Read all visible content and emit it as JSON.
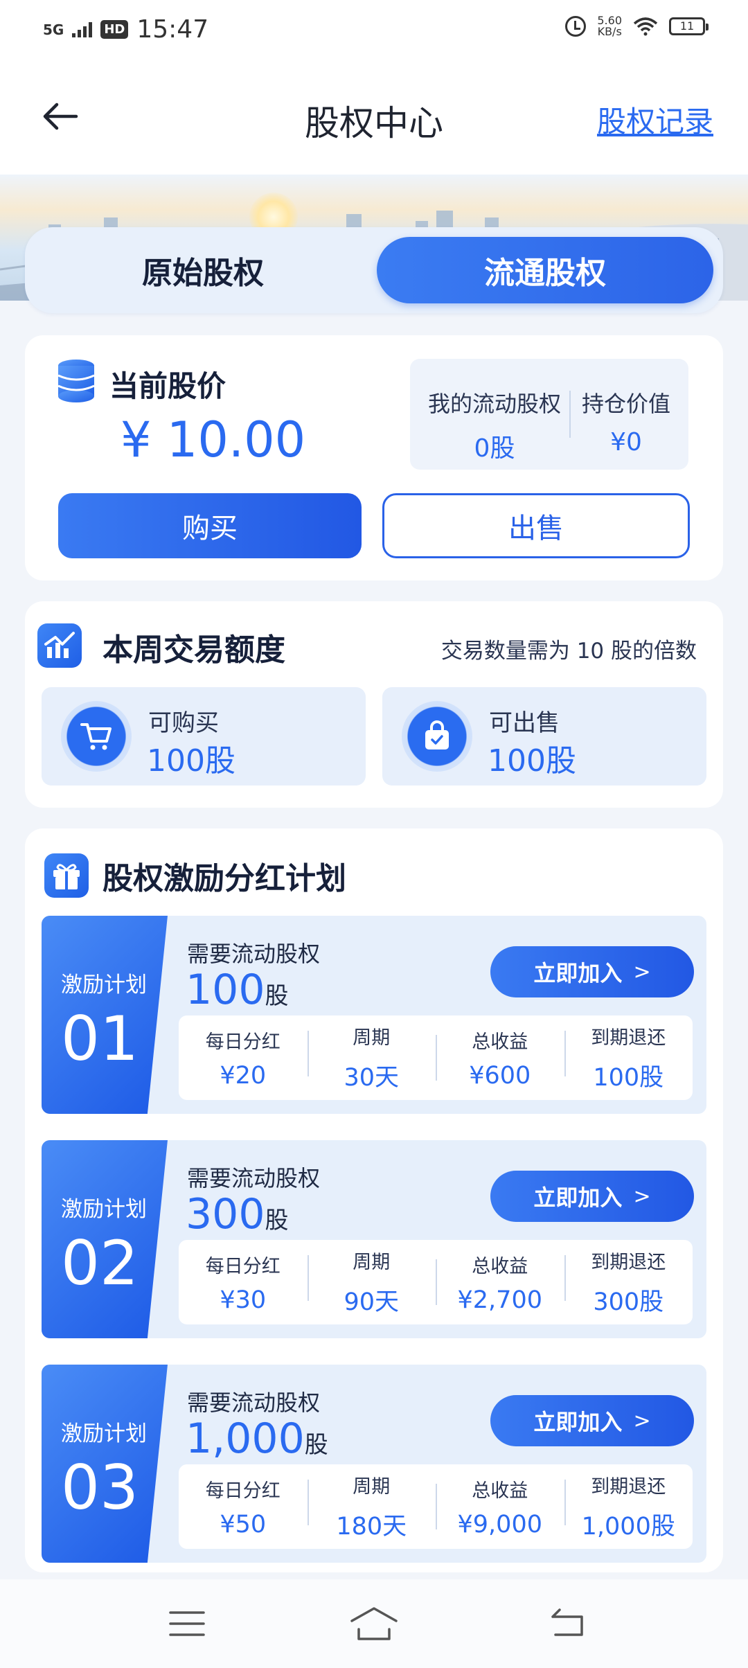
{
  "status_bar": {
    "network": "5G",
    "hd": "HD",
    "time": "15:47",
    "speed_value": "5.60",
    "speed_unit": "KB/s",
    "battery": "11"
  },
  "header": {
    "title": "股权中心",
    "records_link": "股权记录"
  },
  "tabs": [
    {
      "label": "原始股权",
      "active": false
    },
    {
      "label": "流通股权",
      "active": true
    }
  ],
  "price_card": {
    "label": "当前股价",
    "price": "¥ 10.00",
    "my_shares_label": "我的流动股权",
    "my_shares_value": "0股",
    "holding_value_label": "持仓价值",
    "holding_value": "¥0",
    "buy_label": "购买",
    "sell_label": "出售"
  },
  "quota_card": {
    "title": "本周交易额度",
    "note": "交易数量需为 10 股的倍数",
    "buy": {
      "label": "可购买",
      "value": "100股"
    },
    "sell": {
      "label": "可出售",
      "value": "100股"
    }
  },
  "plans_card": {
    "title": "股权激励分红计划",
    "plans": [
      {
        "badge_label": "激励计划",
        "number": "01",
        "requirement_label": "需要流动股权",
        "amount": "100",
        "unit": "股",
        "join_label": "立即加入",
        "stats": [
          {
            "label": "每日分红",
            "value": "¥20"
          },
          {
            "label": "周期",
            "value": "30天"
          },
          {
            "label": "总收益",
            "value": "¥600"
          },
          {
            "label": "到期退还",
            "value": "100股"
          }
        ]
      },
      {
        "badge_label": "激励计划",
        "number": "02",
        "requirement_label": "需要流动股权",
        "amount": "300",
        "unit": "股",
        "join_label": "立即加入",
        "stats": [
          {
            "label": "每日分红",
            "value": "¥30"
          },
          {
            "label": "周期",
            "value": "90天"
          },
          {
            "label": "总收益",
            "value": "¥2,700"
          },
          {
            "label": "到期退还",
            "value": "300股"
          }
        ]
      },
      {
        "badge_label": "激励计划",
        "number": "03",
        "requirement_label": "需要流动股权",
        "amount": "1,000",
        "unit": "股",
        "join_label": "立即加入",
        "stats": [
          {
            "label": "每日分红",
            "value": "¥50"
          },
          {
            "label": "周期",
            "value": "180天"
          },
          {
            "label": "总收益",
            "value": "¥9,000"
          },
          {
            "label": "到期退还",
            "value": "1,000股"
          }
        ]
      }
    ]
  },
  "colors": {
    "accent": "#2a6af0",
    "page_bg": "#f2f5fa",
    "tile_bg": "#e7effb",
    "text_dark": "#16203a"
  }
}
